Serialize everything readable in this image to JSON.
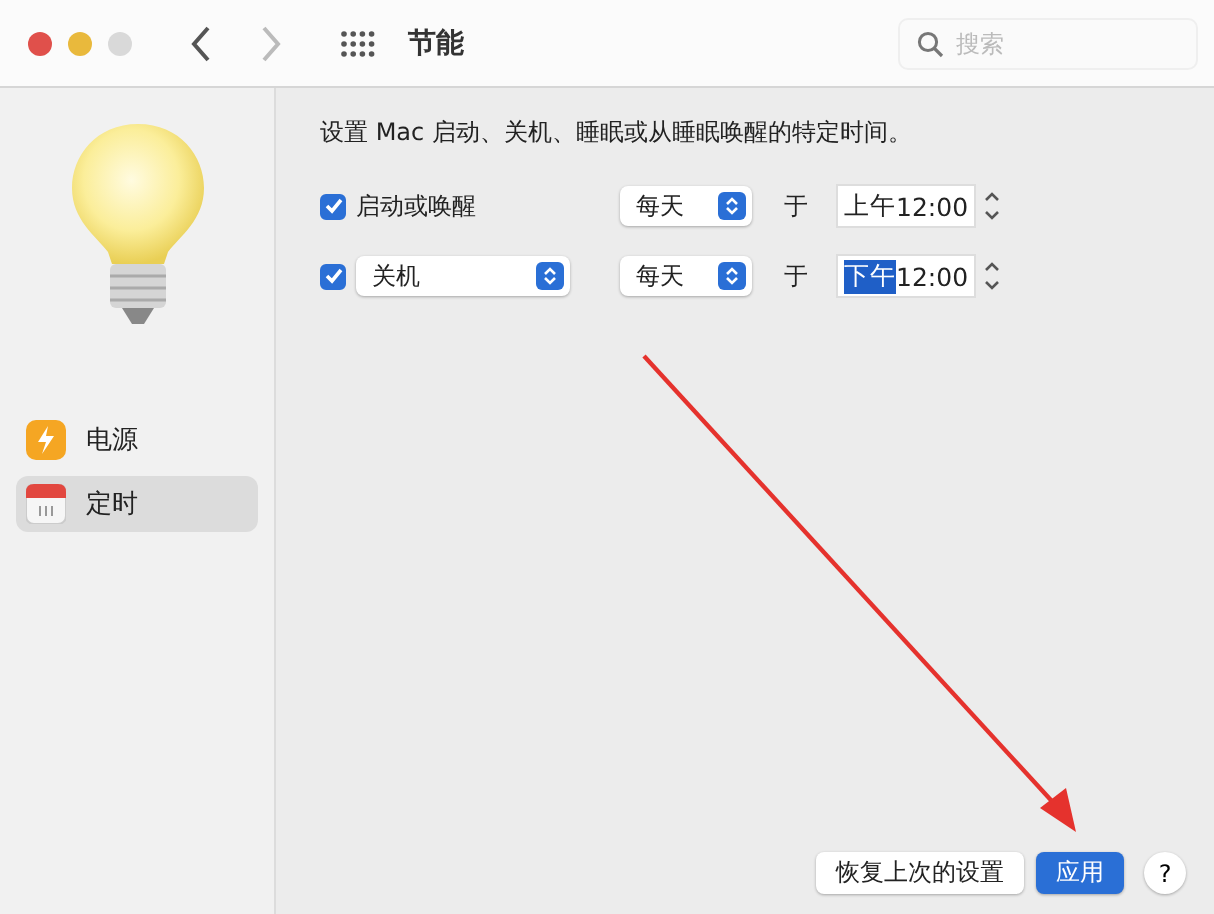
{
  "window": {
    "title": "节能",
    "search_placeholder": "搜索"
  },
  "sidebar": {
    "items": [
      {
        "label": "电源",
        "kind": "power",
        "selected": false
      },
      {
        "label": "定时",
        "kind": "schedule",
        "selected": true
      }
    ]
  },
  "schedule": {
    "description": "设置 Mac 启动、关机、睡眠或从睡眠唤醒的特定时间。",
    "rows": [
      {
        "kind": "label",
        "checked": true,
        "event": "启动或唤醒",
        "repeat": "每天",
        "at": "于",
        "meridiem": "上午",
        "time": "12:00",
        "meridiem_selected": false
      },
      {
        "kind": "popup",
        "checked": true,
        "event": "关机",
        "repeat": "每天",
        "at": "于",
        "meridiem": "下午",
        "time": "12:00",
        "meridiem_selected": true
      }
    ]
  },
  "buttons": [
    {
      "label": "恢复上次的设置",
      "primary": false
    },
    {
      "label": "应用",
      "primary": true
    }
  ],
  "help": "?"
}
